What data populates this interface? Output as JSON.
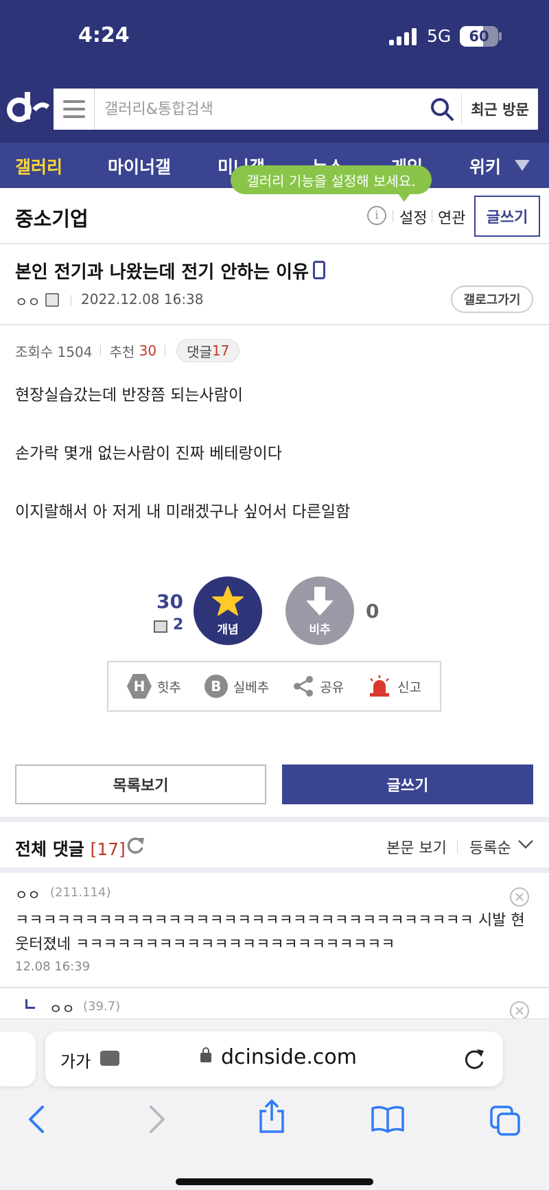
{
  "status": {
    "time": "4:24",
    "network": "5G",
    "battery": "60",
    "battery_level": 0.6
  },
  "search": {
    "placeholder": "갤러리&통합검색",
    "recent_label": "최근 방문"
  },
  "nav": {
    "items": [
      "갤러리",
      "마이너갤",
      "미니갤",
      "뉴스",
      "게임",
      "위키"
    ]
  },
  "tooltip": "갤러리 기능을 설정해 보세요.",
  "gallery": {
    "title": "중소기업",
    "settings": "설정",
    "related": "연관",
    "write": "글쓰기"
  },
  "post": {
    "title": "본인 전기과 나왔는데 전기 안하는 이유",
    "author": "ㅇㅇ",
    "date": "2022.12.08 16:38",
    "gallog": "갤로그가기",
    "views_label": "조회수 1504",
    "recommend_label": "추천",
    "recommend_value": "30",
    "comments_label": "댓글",
    "comments_value": "17",
    "body": [
      "현장실습갔는데 반장쯤 되는사람이",
      "손가락 몇개 없는사람이 진짜 베테랑이다",
      "이지랄해서 아 저게 내 미래겠구나 싶어서 다른일함"
    ]
  },
  "vote": {
    "up_count": "30",
    "fixed_count": "2",
    "up_label": "개념",
    "down_label": "비추",
    "down_count": "0"
  },
  "actions": {
    "hit": "힛추",
    "real": "실베추",
    "share": "공유",
    "report": "신고"
  },
  "buttons": {
    "list": "목록보기",
    "write": "글쓰기"
  },
  "comments_header": {
    "title": "전체 댓글",
    "count": "[17]",
    "view_body": "본문 보기",
    "order": "등록순"
  },
  "comments": [
    {
      "name": "ㅇㅇ",
      "ip": "(211.114)",
      "text": "ㅋㅋㅋㅋㅋㅋㅋㅋㅋㅋㅋㅋㅋㅋㅋㅋㅋㅋㅋㅋㅋㅋㅋㅋㅋㅋㅋㅋㅋㅋㅋㅋㅋ 시발 현웃터졌네 ㅋㅋㅋㅋㅋㅋㅋㅋㅋㅋㅋㅋㅋㅋㅋㅋㅋㅋㅋㅋㅋㅋㅋ",
      "date": "12.08 16:39"
    }
  ],
  "reply": {
    "name": "ㅇㅇ",
    "ip": "(39.7)"
  },
  "browser": {
    "aa": "가가",
    "domain": "dcinside.com"
  },
  "colors": {
    "brand": "#2d3478",
    "nav": "#3b4490",
    "highlight": "#ffd836",
    "tooltip": "#8ac54a",
    "accent_red": "#c0392b"
  }
}
